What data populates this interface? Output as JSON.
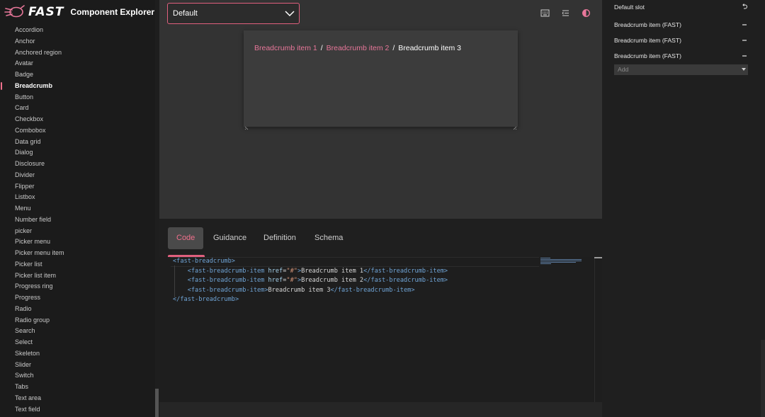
{
  "brand": {
    "logo_text": "FAST",
    "title": "Component Explorer"
  },
  "sidebar": {
    "items": [
      {
        "label": "Accordion"
      },
      {
        "label": "Anchor"
      },
      {
        "label": "Anchored region"
      },
      {
        "label": "Avatar"
      },
      {
        "label": "Badge"
      },
      {
        "label": "Breadcrumb",
        "active": true
      },
      {
        "label": "Button"
      },
      {
        "label": "Card"
      },
      {
        "label": "Checkbox"
      },
      {
        "label": "Combobox"
      },
      {
        "label": "Data grid"
      },
      {
        "label": "Dialog"
      },
      {
        "label": "Disclosure"
      },
      {
        "label": "Divider"
      },
      {
        "label": "Flipper"
      },
      {
        "label": "Listbox"
      },
      {
        "label": "Menu"
      },
      {
        "label": "Number field"
      },
      {
        "label": "picker"
      },
      {
        "label": "Picker menu"
      },
      {
        "label": "Picker menu item"
      },
      {
        "label": "Picker list"
      },
      {
        "label": "Picker list item"
      },
      {
        "label": "Progress ring"
      },
      {
        "label": "Progress"
      },
      {
        "label": "Radio"
      },
      {
        "label": "Radio group"
      },
      {
        "label": "Search"
      },
      {
        "label": "Select"
      },
      {
        "label": "Skeleton"
      },
      {
        "label": "Slider"
      },
      {
        "label": "Switch"
      },
      {
        "label": "Tabs"
      },
      {
        "label": "Text area"
      },
      {
        "label": "Text field"
      }
    ]
  },
  "toolbar": {
    "variant_value": "Default",
    "icons": [
      "keyboard-icon",
      "text-direction-icon",
      "theme-toggle-icon"
    ]
  },
  "preview": {
    "breadcrumb": {
      "items": [
        "Breadcrumb item 1",
        "Breadcrumb item 2",
        "Breadcrumb item 3"
      ],
      "separator": "/"
    }
  },
  "tabs": [
    {
      "label": "Code",
      "active": true
    },
    {
      "label": "Guidance"
    },
    {
      "label": "Definition"
    },
    {
      "label": "Schema"
    }
  ],
  "code": {
    "lines": [
      [
        {
          "t": "tag",
          "v": "<fast-breadcrumb>"
        }
      ],
      [
        {
          "t": "txt",
          "v": "    "
        },
        {
          "t": "tag",
          "v": "<fast-breadcrumb-item "
        },
        {
          "t": "attr",
          "v": "href"
        },
        {
          "t": "txt",
          "v": "="
        },
        {
          "t": "str",
          "v": "\"#\""
        },
        {
          "t": "tag",
          "v": ">"
        },
        {
          "t": "txt",
          "v": "Breadcrumb item 1"
        },
        {
          "t": "tag",
          "v": "</fast-breadcrumb-item>"
        }
      ],
      [
        {
          "t": "txt",
          "v": "    "
        },
        {
          "t": "tag",
          "v": "<fast-breadcrumb-item "
        },
        {
          "t": "attr",
          "v": "href"
        },
        {
          "t": "txt",
          "v": "="
        },
        {
          "t": "str",
          "v": "\"#\""
        },
        {
          "t": "tag",
          "v": ">"
        },
        {
          "t": "txt",
          "v": "Breadcrumb item 2"
        },
        {
          "t": "tag",
          "v": "</fast-breadcrumb-item>"
        }
      ],
      [
        {
          "t": "txt",
          "v": "    "
        },
        {
          "t": "tag",
          "v": "<fast-breadcrumb-item>"
        },
        {
          "t": "txt",
          "v": "Breadcrumb item 3"
        },
        {
          "t": "tag",
          "v": "</fast-breadcrumb-item>"
        }
      ],
      [
        {
          "t": "tag",
          "v": "</fast-breadcrumb>"
        }
      ]
    ]
  },
  "inspector": {
    "slot_label": "Default slot",
    "items": [
      {
        "label": "Breadcrumb item (FAST)"
      },
      {
        "label": "Breadcrumb item (FAST)"
      },
      {
        "label": "Breadcrumb item (FAST)"
      }
    ],
    "add_placeholder": "Add"
  },
  "colors": {
    "accent": "#e0607e",
    "link": "#e8779a",
    "stage": "#333333",
    "card": "#3c3c3c"
  }
}
